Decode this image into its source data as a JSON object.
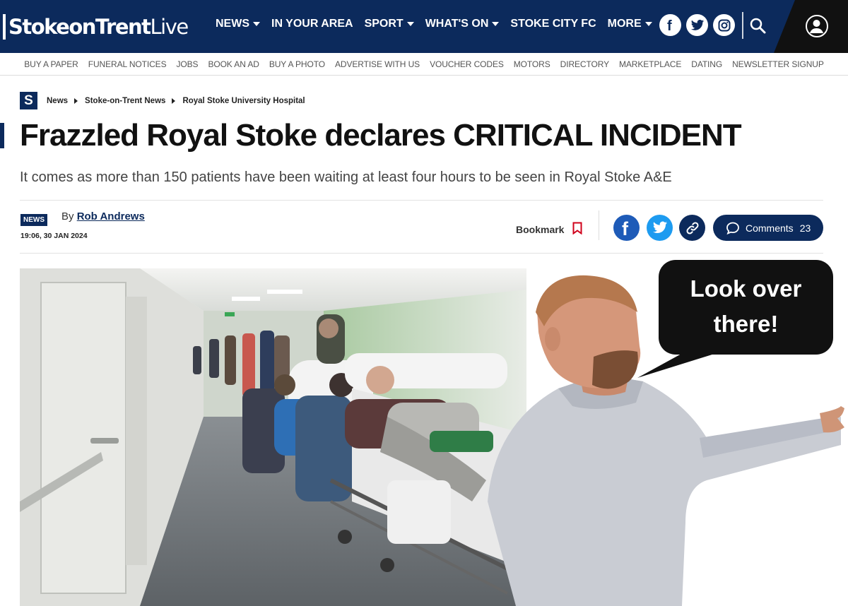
{
  "site": {
    "logo_bold": "StokeonTrent",
    "logo_light": "Live",
    "accent": "#0c2a5c"
  },
  "main_nav": [
    {
      "label": "NEWS",
      "dropdown": true
    },
    {
      "label": "IN YOUR AREA",
      "dropdown": false
    },
    {
      "label": "SPORT",
      "dropdown": true
    },
    {
      "label": "WHAT'S ON",
      "dropdown": true
    },
    {
      "label": "STOKE CITY FC",
      "dropdown": false
    },
    {
      "label": "MORE",
      "dropdown": true
    }
  ],
  "header_icons": [
    "facebook-icon",
    "twitter-icon",
    "instagram-icon",
    "search-icon",
    "account-icon"
  ],
  "sub_nav": [
    "BUY A PAPER",
    "FUNERAL NOTICES",
    "JOBS",
    "BOOK AN AD",
    "BUY A PHOTO",
    "ADVERTISE WITH US",
    "VOUCHER CODES",
    "MOTORS",
    "DIRECTORY",
    "MARKETPLACE",
    "DATING",
    "NEWSLETTER SIGNUP"
  ],
  "breadcrumb": {
    "logo_letter": "S",
    "items": [
      "News",
      "Stoke-on-Trent News",
      "Royal Stoke University Hospital"
    ]
  },
  "article": {
    "headline": "Frazzled Royal Stoke declares CRITICAL INCIDENT",
    "standfirst": "It comes as more than 150 patients have been waiting at least four hours to be seen in Royal Stoke A&E",
    "tag": "NEWS",
    "by_prefix": "By",
    "author": "Rob Andrews",
    "date": "19:06, 30 JAN 2024"
  },
  "actions": {
    "bookmark_label": "Bookmark",
    "comments_label": "Comments",
    "comments_count": "23"
  },
  "meme": {
    "speech_line1": "Look over",
    "speech_line2": "there!"
  }
}
